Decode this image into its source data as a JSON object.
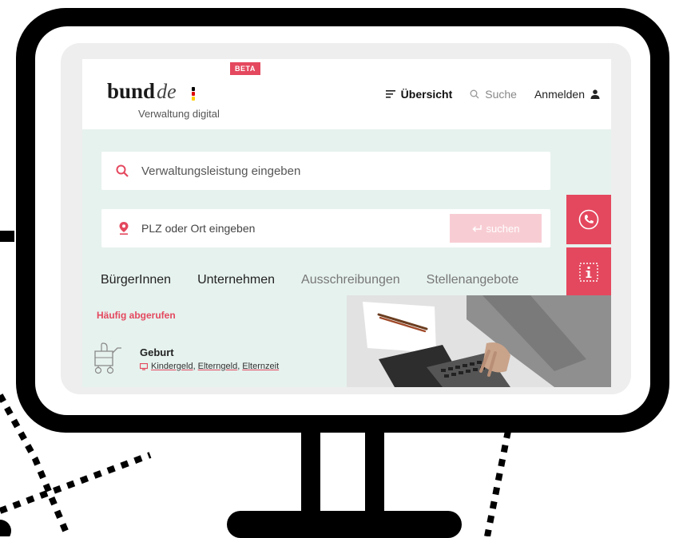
{
  "header": {
    "logo_word": "bund",
    "logo_suffix": "de",
    "logo_subtitle": "Verwaltung digital",
    "beta_badge": "BETA",
    "nav": {
      "overview_label": "Übersicht",
      "search_label": "Suche",
      "login_label": "Anmelden"
    }
  },
  "hero": {
    "service_search_placeholder": "Verwaltungsleistung eingeben",
    "location_placeholder": "PLZ oder Ort eingeben",
    "search_button_label": "suchen",
    "tabs": [
      {
        "label": "BürgerInnen"
      },
      {
        "label": "Unternehmen"
      },
      {
        "label": "Ausschreibungen"
      },
      {
        "label": "Stellenangebote"
      }
    ]
  },
  "frequent": {
    "title": "Häufig abgerufen",
    "items": [
      {
        "title": "Geburt",
        "links": [
          "Kindergeld",
          "Elterngeld",
          "Elternzeit"
        ]
      }
    ]
  },
  "icons": {
    "overview": "menu-lines-icon",
    "search": "search-icon",
    "login": "user-icon",
    "phone": "phone-icon",
    "info": "info-icon",
    "location": "location-pin-icon",
    "stroller": "stroller-icon",
    "laptop": "laptop-icon"
  },
  "colors": {
    "accent": "#e4485e",
    "hero_background": "#e6f2ee",
    "button_disabled": "#f7cdd3",
    "flag_black": "#000000",
    "flag_red": "#dd0000",
    "flag_gold": "#ffce00"
  }
}
